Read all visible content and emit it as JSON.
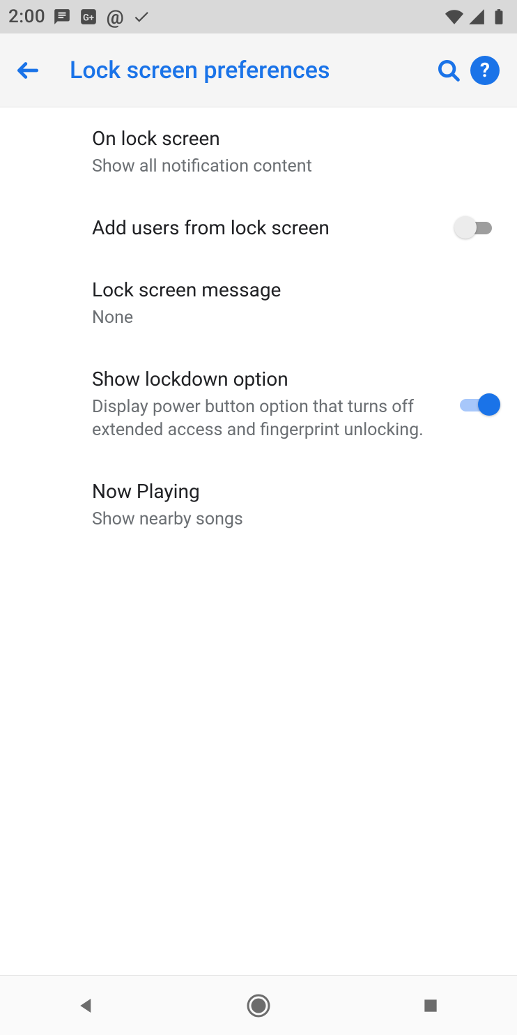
{
  "statusbar": {
    "time": "2:00"
  },
  "appbar": {
    "title": "Lock screen preferences"
  },
  "items": {
    "on_lock_screen": {
      "title": "On lock screen",
      "subtitle": "Show all notification content"
    },
    "add_users": {
      "title": "Add users from lock screen",
      "toggle": false
    },
    "message": {
      "title": "Lock screen message",
      "subtitle": "None"
    },
    "lockdown": {
      "title": "Show lockdown option",
      "subtitle": "Display power button option that turns off extended access and fingerprint unlocking.",
      "toggle": true
    },
    "now_playing": {
      "title": "Now Playing",
      "subtitle": "Show nearby songs"
    }
  }
}
